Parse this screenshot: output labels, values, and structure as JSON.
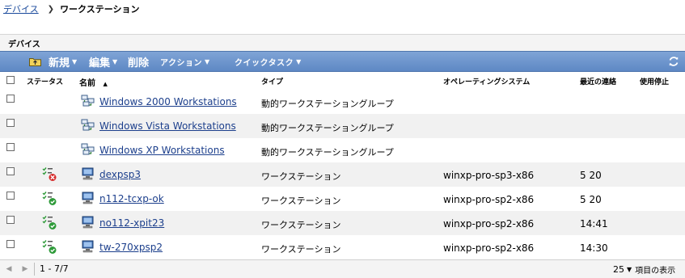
{
  "breadcrumb": {
    "parent": "デバイス",
    "separator": "❯",
    "current": "ワークステーション"
  },
  "panel": {
    "title": "デバイス"
  },
  "toolbar": {
    "new_label": "新規",
    "edit_label": "編集",
    "delete_label": "削除",
    "action_label": "アクション",
    "quicktask_label": "クイックタスク",
    "caret": "▼"
  },
  "columns": {
    "status": "ステータス",
    "name": "名前",
    "sort_indicator": "▲",
    "type": "タイプ",
    "os": "オペレーティングシステム",
    "last_contact": "最近の連絡",
    "disabled": "使用停止"
  },
  "rows": [
    {
      "name": "Windows 2000 Workstations",
      "type": "動的ワークステーショングループ",
      "os": "",
      "last_contact": "",
      "kind": "group",
      "status": "none"
    },
    {
      "name": "Windows Vista Workstations",
      "type": "動的ワークステーショングループ",
      "os": "",
      "last_contact": "",
      "kind": "group",
      "status": "none"
    },
    {
      "name": "Windows XP Workstations",
      "type": "動的ワークステーショングループ",
      "os": "",
      "last_contact": "",
      "kind": "group",
      "status": "none"
    },
    {
      "name": "dexpsp3",
      "type": "ワークステーション",
      "os": "winxp-pro-sp3-x86",
      "last_contact": "5 20",
      "kind": "workstation",
      "status": "error"
    },
    {
      "name": "n112-tcxp-ok",
      "type": "ワークステーション",
      "os": "winxp-pro-sp2-x86",
      "last_contact": "5 20",
      "kind": "workstation",
      "status": "ok"
    },
    {
      "name": "no112-xpit23",
      "type": "ワークステーション",
      "os": "winxp-pro-sp2-x86",
      "last_contact": "14:41",
      "kind": "workstation",
      "status": "ok"
    },
    {
      "name": "tw-270xpsp2",
      "type": "ワークステーション",
      "os": "winxp-pro-sp2-x86",
      "last_contact": "14:30",
      "kind": "workstation",
      "status": "ok"
    }
  ],
  "footer": {
    "prev_arrow": "◀",
    "next_arrow": "▶",
    "range": "1 - 7/7",
    "page_size": "25",
    "page_size_caret": "▼",
    "page_size_label": "項目の表示"
  },
  "colors": {
    "toolbar_bg": "#6a92cb",
    "link": "#1c3f8c",
    "row_alt": "#f1f1f1",
    "status_ok": "#2f9b3a",
    "status_error": "#d62b2b"
  },
  "icons": {
    "folder": "folder-up-icon",
    "refresh": "refresh-icon",
    "group": "workstation-group-icon",
    "workstation": "workstation-icon",
    "status_ok": "status-ok-icon",
    "status_error": "status-error-icon"
  }
}
